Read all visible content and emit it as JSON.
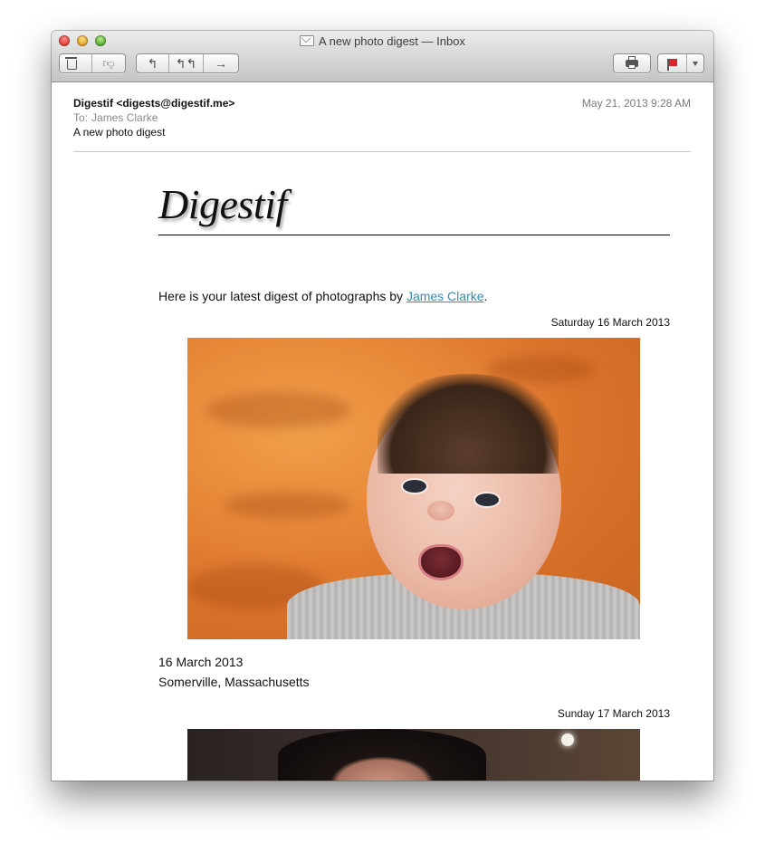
{
  "window": {
    "title": "A new photo digest — Inbox"
  },
  "message": {
    "from": "Digestif <digests@digestif.me>",
    "to_label": "To:",
    "to_name": "James Clarke",
    "subject": "A new photo digest",
    "date": "May 21, 2013  9:28 AM"
  },
  "email_body": {
    "masthead": "Digestif",
    "intro_prefix": "Here is your latest digest of photographs by ",
    "intro_link": "James Clarke",
    "intro_suffix": ".",
    "days": [
      {
        "heading": "Saturday 16 March 2013",
        "caption_date": "16 March 2013",
        "caption_place": "Somerville, Massachusetts"
      },
      {
        "heading": "Sunday 17 March 2013"
      }
    ]
  },
  "icons": {
    "trash": "trash-icon",
    "junk": "thumbs-down-icon",
    "reply": "reply-icon",
    "reply_all": "reply-all-icon",
    "forward": "forward-icon",
    "print": "printer-icon",
    "flag": "flag-icon",
    "flag_color": "#d9262b"
  },
  "colors": {
    "link": "#2f8fb0"
  }
}
